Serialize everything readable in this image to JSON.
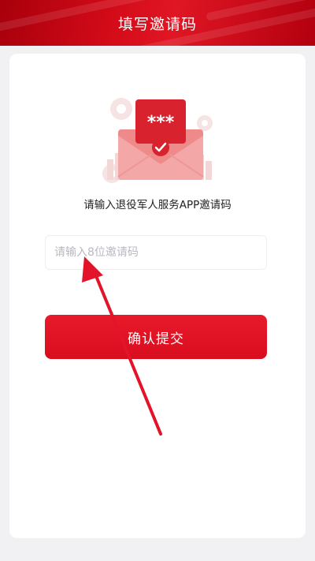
{
  "header": {
    "title": "填写邀请码"
  },
  "illustration": {
    "stars": "***"
  },
  "form": {
    "prompt": "请输入退役军人服务APP邀请码",
    "input_placeholder": "请输入8位邀请码",
    "input_value": "",
    "submit_label": "确认提交"
  },
  "colors": {
    "brand_red": "#d80d1d",
    "header_red": "#c4000f",
    "annotation_arrow": "#e3142a"
  }
}
